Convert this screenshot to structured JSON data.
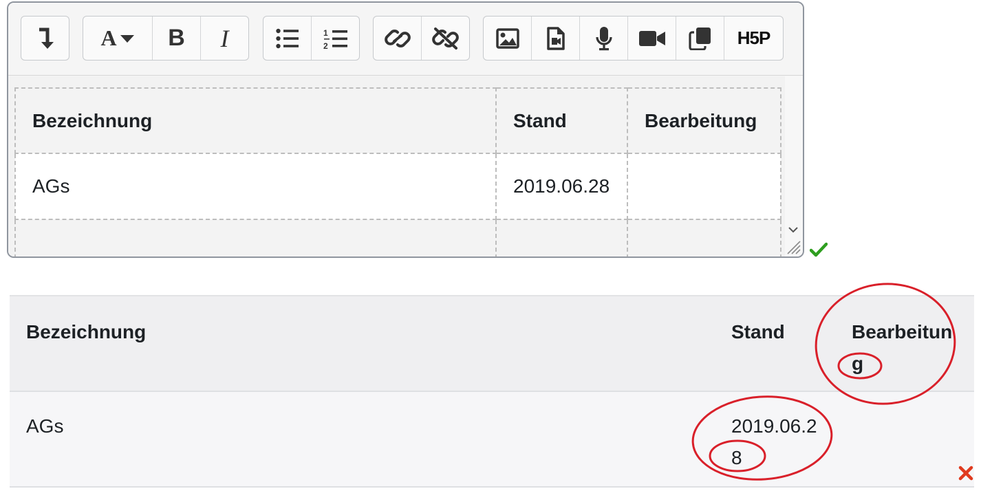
{
  "toolbar": {
    "buttons": [
      "show-more-icon",
      "font-style-icon",
      "bold-icon",
      "italic-icon",
      "bullet-list-icon",
      "numbered-list-icon",
      "link-icon",
      "unlink-icon",
      "image-icon",
      "media-icon",
      "microphone-icon",
      "video-icon",
      "copy-icon",
      "h5p-icon"
    ],
    "font_label": "A",
    "bold_label": "B",
    "italic_label": "I",
    "h5p_label": "H5P"
  },
  "editor_table": {
    "headers": [
      "Bezeichnung",
      "Stand",
      "Bearbeitung"
    ],
    "rows": [
      [
        "AGs",
        "2019.06.28",
        ""
      ],
      [
        "",
        "",
        ""
      ]
    ]
  },
  "rendered_table": {
    "headers": [
      "Bezeichnung",
      "Stand",
      "Bearbeitun",
      "g"
    ],
    "rows": [
      [
        "AGs",
        "2019.06.2",
        "8",
        ""
      ]
    ]
  },
  "colors": {
    "annotation": "#d9202a",
    "check": "#2e9e1f",
    "cross": "#e03a1e"
  }
}
